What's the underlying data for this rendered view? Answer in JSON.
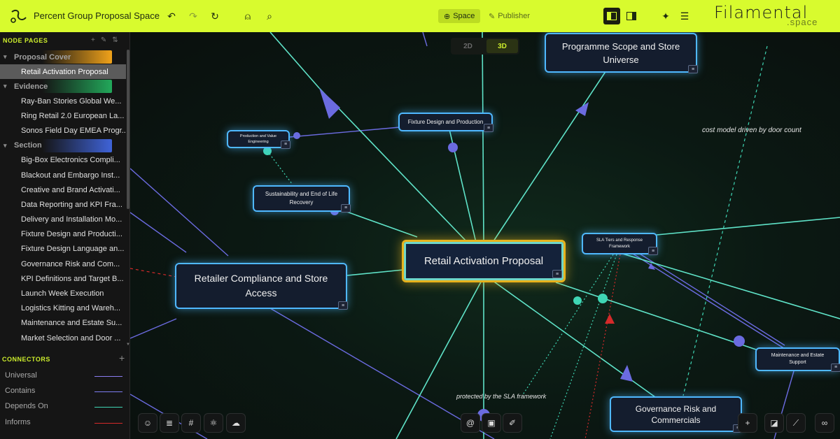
{
  "app": {
    "title": "Percent Group Proposal Space",
    "brand": "Filamental",
    "brand_sub": ".space"
  },
  "toolbar": {
    "undo_icon": "undo-icon",
    "redo_icon": "redo-icon",
    "refresh_icon": "refresh-icon",
    "person_icon": "person-icon",
    "search_icon": "search-icon",
    "space_label": "Space",
    "publisher_label": "Publisher",
    "sparkle_icon": "sparkle-icon",
    "menu_icon": "hamburger-menu-icon"
  },
  "sidebar": {
    "heading": "NODE PAGES",
    "groups": [
      {
        "label": "Proposal Cover",
        "color": "#f0a21a",
        "items": [
          "Retail Activation Proposal"
        ]
      },
      {
        "label": "Evidence",
        "color": "#22a85a",
        "items": [
          "Ray-Ban Stories Global We...",
          "Ring Retail 2.0 European La...",
          "Sonos Field Day EMEA Progr..."
        ]
      },
      {
        "label": "Section",
        "color": "#3f63d8",
        "items": [
          "Big-Box Electronics Compli...",
          "Blackout and Embargo Inst...",
          "Creative and Brand Activati...",
          "Data Reporting and KPI Fra...",
          "Delivery and Installation Mo...",
          "Fixture Design and Producti...",
          "Fixture Design Language an...",
          "Governance Risk and Com...",
          "KPI Definitions and Target B...",
          "Launch Week Execution",
          "Logistics Kitting and Wareh...",
          "Maintenance and Estate Su...",
          "Market Selection and Door ..."
        ]
      }
    ],
    "selected": "Retail Activation Proposal"
  },
  "connectors": {
    "heading": "CONNECTORS",
    "items": [
      {
        "label": "Universal",
        "color": "#8b7cf0"
      },
      {
        "label": "Contains",
        "color": "#7c7cf0"
      },
      {
        "label": "Depends On",
        "color": "#3fd6b4"
      },
      {
        "label": "Informs",
        "color": "#d42a2a"
      }
    ]
  },
  "view_toggle": {
    "option_2d": "2D",
    "option_3d": "3D",
    "active": "3D"
  },
  "nodes": {
    "main": "Retail Activation Proposal",
    "programme": "Programme Scope and Store Universe",
    "fixture": "Fixture Design and Production",
    "production": "Production and Value Engineering",
    "sustainability": "Sustainability and End of Life Recovery",
    "retailer": "Retailer Compliance and Store Access",
    "sla": "SLA Tiers and Response Framework",
    "maintenance": "Maintenance and Estate Support",
    "governance": "Governance Risk and Commercials"
  },
  "annotations": {
    "cost_model": "cost model driven by door count",
    "protected": "protected by the SLA framework"
  },
  "bottom_tools": [
    "alien-icon",
    "align-icon",
    "hash-icon",
    "react-icon",
    "cloud-icon",
    "spiral-icon",
    "camera-icon",
    "brush-icon",
    "plus-icon",
    "page-edit-icon",
    "magic-wand-icon",
    "link-icon"
  ]
}
